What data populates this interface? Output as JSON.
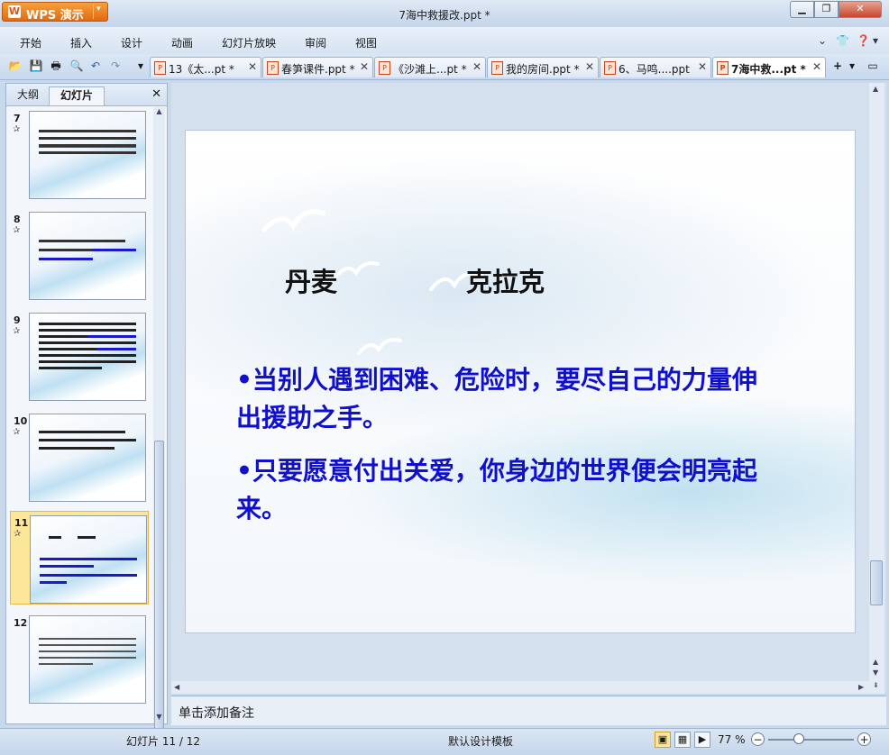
{
  "titlebar": {
    "app_button_label": "WPS 演示",
    "window_title": "7海中救援改.ppt *",
    "min_glyph": "▁",
    "max_glyph": "❐",
    "close_glyph": "✕"
  },
  "menu": {
    "items": [
      "开始",
      "插入",
      "设计",
      "动画",
      "幻灯片放映",
      "审阅",
      "视图"
    ],
    "right_icons": [
      "chevron-down-icon",
      "shirt-icon",
      "help-icon"
    ]
  },
  "tabs": [
    {
      "label": "13《太...pt *",
      "active": false
    },
    {
      "label": "春笋课件.ppt *",
      "active": false
    },
    {
      "label": "《沙滩上...pt *",
      "active": false
    },
    {
      "label": "我的房间.ppt *",
      "active": false
    },
    {
      "label": "6、马鸣....ppt",
      "active": false
    },
    {
      "label": "7海中救...pt *",
      "active": true
    }
  ],
  "left_pane": {
    "tab_outline": "大纲",
    "tab_slides": "幻灯片",
    "close_glyph": "✕",
    "star_glyph": "✰",
    "slides": [
      {
        "number": "7",
        "selected": false
      },
      {
        "number": "8",
        "selected": false
      },
      {
        "number": "9",
        "selected": false
      },
      {
        "number": "10",
        "selected": false
      },
      {
        "number": "11",
        "selected": true
      },
      {
        "number": "12",
        "selected": false
      }
    ]
  },
  "slide": {
    "heading_1": "丹麦",
    "heading_2": "克拉克",
    "bullet_1": "•当别人遇到困难、危险时，要尽自己的力量伸出援助之手。",
    "bullet_2": "•只要愿意付出关爱，你身边的世界便会明亮起来。",
    "bullet_color": "#1010cc"
  },
  "notes": {
    "placeholder": "单击添加备注"
  },
  "status": {
    "slide_counter": "幻灯片 11 / 12",
    "template": "默认设计模板",
    "zoom": "77 %"
  }
}
